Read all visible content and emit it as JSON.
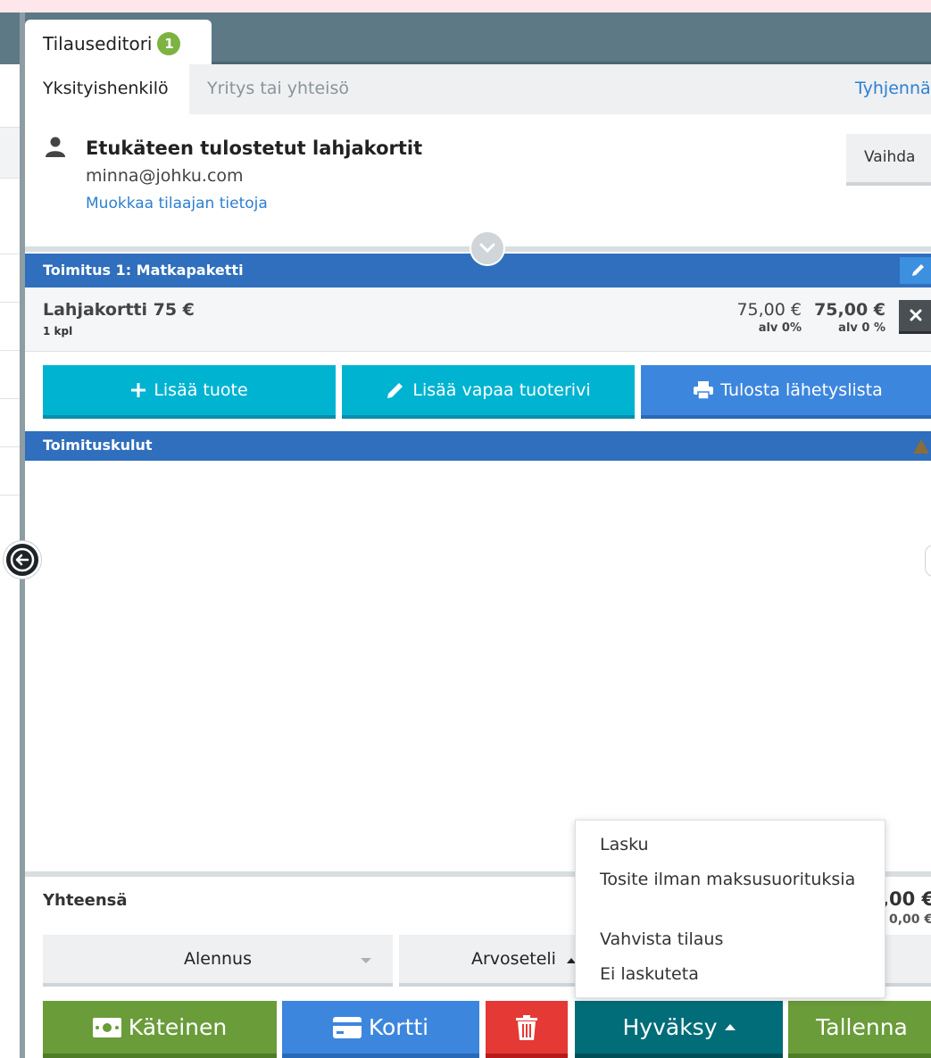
{
  "window": {
    "tab_title": "Tilauseditori",
    "tab_badge": "1"
  },
  "subtabs": {
    "private": "Yksityishenkilö",
    "company": "Yritys tai yhteisö",
    "clear": "Tyhjennä"
  },
  "customer": {
    "name": "Etukäteen tulostetut lahjakortit",
    "email": "minna@johku.com",
    "edit_link": "Muokkaa tilaajan tietoja",
    "change_button": "Vaihda"
  },
  "delivery": {
    "title": "Toimitus 1: Matkapaketti",
    "item": {
      "name": "Lahjakortti 75 €",
      "qty": "1 kpl",
      "unit_price": "75,00 €",
      "unit_tax": "alv 0%",
      "total": "75,00 €",
      "total_tax": "alv 0 %"
    },
    "buttons": {
      "add_product": "Lisää tuote",
      "add_free_row": "Lisää vapaa tuoterivi",
      "print_list": "Tulosta lähetyslista"
    }
  },
  "shipping": {
    "title": "Toimituskulut"
  },
  "totals": {
    "label": "Yhteensä",
    "amount": ",00 €",
    "amount_sub": "0,00 €"
  },
  "selects": {
    "discount": "Alennus",
    "voucher": "Arvoseteli"
  },
  "payment": {
    "cash": "Käteinen",
    "card": "Kortti",
    "approve": "Hyväksy",
    "save": "Tallenna"
  },
  "approve_menu": {
    "items": [
      "Lasku",
      "Tosite ilman maksusuorituksia",
      "Vahvista tilaus",
      "Ei laskuteta"
    ]
  },
  "colors": {
    "header": "#5d7985",
    "section_bar": "#2f6fbd",
    "cyan": "#00b3d1",
    "blue": "#3d86dd",
    "green": "#6a9c3a",
    "red": "#e53935",
    "teal": "#006d78",
    "link": "#2d7fd2"
  }
}
